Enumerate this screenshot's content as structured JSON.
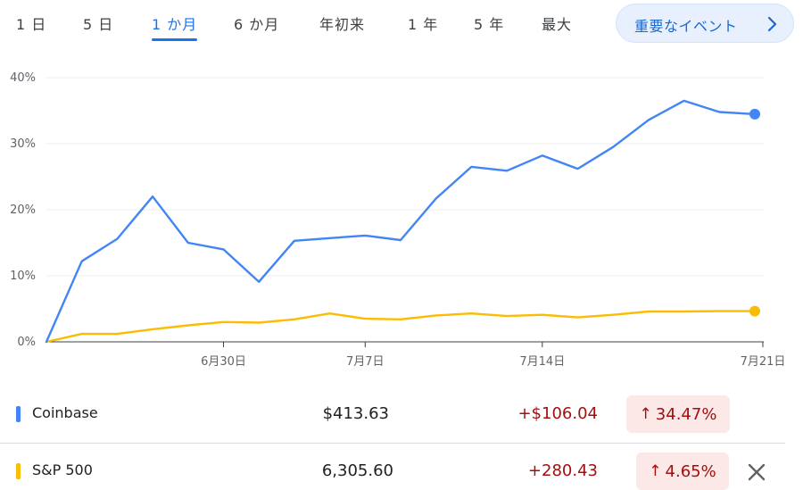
{
  "tabs": [
    {
      "label": "1 日",
      "active": false
    },
    {
      "label": "5 日",
      "active": false
    },
    {
      "label": "1 か月",
      "active": true
    },
    {
      "label": "6 か月",
      "active": false
    },
    {
      "label": "年初来",
      "active": false
    },
    {
      "label": "1 年",
      "active": false
    },
    {
      "label": "5 年",
      "active": false
    },
    {
      "label": "最大",
      "active": false
    }
  ],
  "events_button": {
    "label": "重要なイベント",
    "icon": "chevron-right-icon"
  },
  "chart_data": {
    "type": "line",
    "y_ticks": [
      "0%",
      "10%",
      "20%",
      "30%",
      "40%"
    ],
    "ylim": [
      0,
      40
    ],
    "x_ticks": [
      {
        "label": "6月30日",
        "index": 5
      },
      {
        "label": "7月7日",
        "index": 9
      },
      {
        "label": "7月14日",
        "index": 14
      },
      {
        "label": "7月21日",
        "index": 19
      }
    ],
    "grid": true,
    "series": [
      {
        "name": "Coinbase",
        "color": "#4285f4",
        "values": [
          0,
          12.2,
          15.6,
          22.0,
          15.0,
          14.0,
          9.1,
          15.3,
          15.7,
          16.1,
          15.4,
          21.7,
          26.5,
          25.9,
          28.2,
          26.2,
          29.5,
          33.6,
          36.5,
          34.8,
          34.47
        ]
      },
      {
        "name": "S&P 500",
        "color": "#fbbc04",
        "values": [
          0,
          1.2,
          1.2,
          1.9,
          2.5,
          3.0,
          2.9,
          3.4,
          4.3,
          3.5,
          3.4,
          4.0,
          4.3,
          3.9,
          4.1,
          3.7,
          4.1,
          4.6,
          4.6,
          4.65,
          4.65
        ]
      }
    ]
  },
  "rows": [
    {
      "name": "Coinbase",
      "color": "#4285f4",
      "price": "$413.63",
      "change": "+$106.04",
      "pct": "34.47%",
      "closable": false
    },
    {
      "name": "S&P 500",
      "color": "#fbbc04",
      "price": "6,305.60",
      "change": "+280.43",
      "pct": "4.65%",
      "closable": true
    }
  ]
}
